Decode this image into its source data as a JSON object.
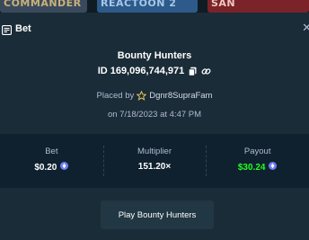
{
  "thumbnails": [
    {
      "text": "COMMANDER"
    },
    {
      "text": "REACTOON 2"
    },
    {
      "text": "SAN"
    }
  ],
  "header": {
    "title": "Bet"
  },
  "game": {
    "title": "Bounty Hunters",
    "id_prefix": "ID",
    "id_value": "169,096,744,971"
  },
  "placed": {
    "prefix": "Placed by",
    "username": "Dgnr8SupraFam",
    "date_text": "on 7/18/2023 at 4:47 PM"
  },
  "stats": {
    "bet": {
      "label": "Bet",
      "value": "$0.20"
    },
    "multiplier": {
      "label": "Multiplier",
      "value": "151.20×"
    },
    "payout": {
      "label": "Payout",
      "value": "$30.24"
    }
  },
  "actions": {
    "play_label": "Play Bounty Hunters"
  },
  "colors": {
    "background": "#1a2c38",
    "stats_background": "#0f212e",
    "button_background": "#213743",
    "payout_green": "#1fff20",
    "coin_blue": "#6f7cf7",
    "muted_text": "#b1bad3"
  },
  "icons": {
    "header": "bet-receipt-icon",
    "close": "close-icon",
    "copy": "copy-icon",
    "link": "link-icon",
    "user_badge": "star-icon",
    "currency": "coin-icon"
  }
}
